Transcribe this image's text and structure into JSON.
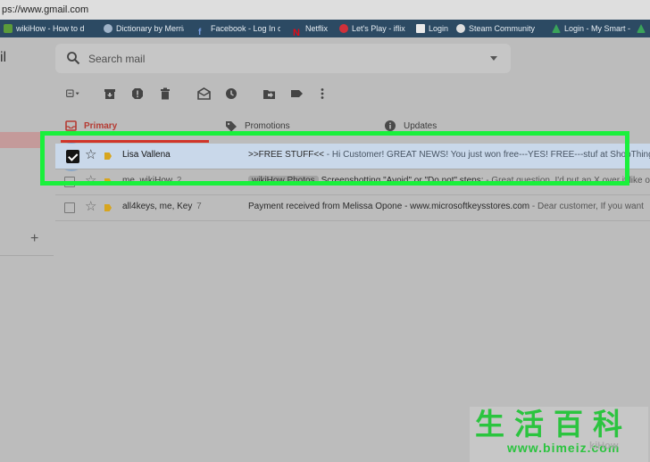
{
  "browser": {
    "url": "ps://www.gmail.com",
    "bookmarks": [
      {
        "label": "wikiHow - How to d",
        "icon": "wikihow-icon",
        "color": "#5b9b3a"
      },
      {
        "label": "Dictionary by Merria",
        "icon": "dictionary-icon",
        "color": "#9fb3c8"
      },
      {
        "label": "Facebook - Log In or",
        "icon": "facebook-icon",
        "color": "#3b5998"
      },
      {
        "label": "Netflix",
        "icon": "netflix-icon",
        "color": "#e50914"
      },
      {
        "label": "Let's Play - iflix",
        "icon": "iflix-icon",
        "color": "#d0303a"
      },
      {
        "label": "Login",
        "icon": "page-icon",
        "color": "#e9e9e9"
      },
      {
        "label": "Steam Community ::",
        "icon": "steam-icon",
        "color": "#dddddd"
      },
      {
        "label": "Login - My Smart -",
        "icon": "smart-icon",
        "color": "#3aa35a"
      }
    ]
  },
  "app": {
    "brand_fragment": "il"
  },
  "search": {
    "placeholder": "Search mail"
  },
  "toolbar": {
    "icons": [
      "select-checkbox-icon",
      "archive-icon",
      "report-spam-icon",
      "delete-icon",
      "mark-read-icon",
      "snooze-icon",
      "move-to-icon",
      "label-icon",
      "more-icon"
    ]
  },
  "tabs": [
    {
      "label": "Primary",
      "icon": "inbox-icon",
      "active": true
    },
    {
      "label": "Promotions",
      "icon": "tag-icon",
      "active": false
    },
    {
      "label": "Updates",
      "icon": "info-icon",
      "active": false
    }
  ],
  "emails": [
    {
      "sender": "Lisa Vallena",
      "count": "",
      "chip": "",
      "subject": ">>FREE STUFF<<",
      "snippet": " - Hi Customer! GREAT NEWS! You just won free---YES! FREE---stuf at ShopThings.co",
      "selected": true
    },
    {
      "sender": "me, wikiHow",
      "count": "2",
      "chip": "wikiHow Photos",
      "subject": "Screenshotting \"Avoid\" or \"Do not\" steps:",
      "snippet": " - Great question. I'd put an X over it like ot",
      "selected": false
    },
    {
      "sender": "all4keys, me, Key",
      "count": "7",
      "chip": "",
      "subject": "Payment received from Melissa Opone - www.microsoftkeysstores.com",
      "snippet": " - Dear customer, If you want",
      "selected": false
    }
  ],
  "colors": {
    "highlight_frame": "#1af03c",
    "primary_tab": "#d0352a",
    "selected_row": "#c9d8ea"
  },
  "watermark": {
    "chars": "生活百科",
    "url": "www.bimeiz.com",
    "ghost": "kiHow"
  }
}
